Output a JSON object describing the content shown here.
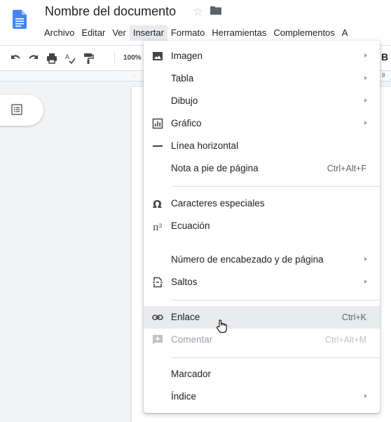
{
  "header": {
    "doc_title": "Nombre del documento",
    "menus": [
      "Archivo",
      "Editar",
      "Ver",
      "Insertar",
      "Formato",
      "Herramientas",
      "Complementos",
      "A"
    ]
  },
  "toolbar": {
    "zoom": "100%",
    "bold_label": "B",
    "icons": [
      "undo-icon",
      "redo-icon",
      "print-icon",
      "spellcheck-icon",
      "paint-format-icon"
    ]
  },
  "ruler": {
    "left_mark": "· ·",
    "number": "8"
  },
  "dropdown": {
    "items": [
      {
        "label": "Imagen",
        "shortcut": "",
        "submenu": true,
        "icon": "image-icon"
      },
      {
        "label": "Tabla",
        "shortcut": "",
        "submenu": true,
        "icon": ""
      },
      {
        "label": "Dibujo",
        "shortcut": "",
        "submenu": true,
        "icon": ""
      },
      {
        "label": "Gráfico",
        "shortcut": "",
        "submenu": true,
        "icon": "chart-icon"
      },
      {
        "label": "Línea horizontal",
        "shortcut": "",
        "submenu": false,
        "icon": "horizontal-line-icon"
      },
      {
        "label": "Nota a pie de página",
        "shortcut": "Ctrl+Alt+F",
        "submenu": false,
        "icon": ""
      },
      {
        "label": "Caracteres especiales",
        "shortcut": "",
        "submenu": false,
        "icon": "omega-icon"
      },
      {
        "label": "Ecuación",
        "shortcut": "",
        "submenu": false,
        "icon": "pi-icon",
        "icon_text": "π²"
      },
      {
        "label": "Número de encabezado y de página",
        "shortcut": "",
        "submenu": true,
        "icon": ""
      },
      {
        "label": "Saltos",
        "shortcut": "",
        "submenu": true,
        "icon": "page-break-icon"
      },
      {
        "label": "Enlace",
        "shortcut": "Ctrl+K",
        "submenu": false,
        "icon": "link-icon"
      },
      {
        "label": "Comentar",
        "shortcut": "Ctrl+Alt+M",
        "submenu": false,
        "icon": "add-comment-icon"
      },
      {
        "label": "Marcador",
        "shortcut": "",
        "submenu": false,
        "icon": ""
      },
      {
        "label": "Índice",
        "shortcut": "",
        "submenu": true,
        "icon": ""
      }
    ]
  },
  "colors": {
    "docs_blue": "#4285f4",
    "hover": "#e8eaed",
    "disabled_text": "#9aa0a6"
  }
}
